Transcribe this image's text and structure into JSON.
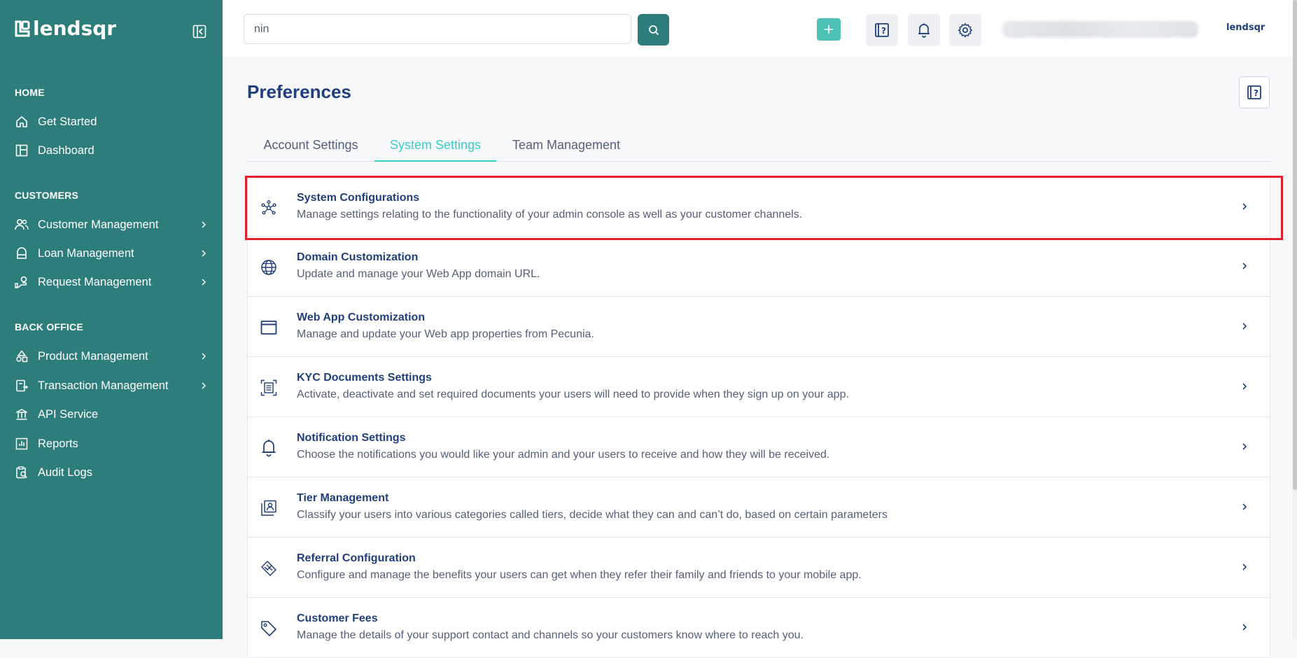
{
  "brand": {
    "name": "lendsqr",
    "small_name": "lendsqr"
  },
  "sidebar": {
    "sections": [
      {
        "label": "HOME",
        "items": [
          {
            "label": "Get Started",
            "icon": "home-icon",
            "has_submenu": false
          },
          {
            "label": "Dashboard",
            "icon": "dashboard-icon",
            "has_submenu": false
          }
        ]
      },
      {
        "label": "CUSTOMERS",
        "items": [
          {
            "label": "Customer Management",
            "icon": "users-icon",
            "has_submenu": true
          },
          {
            "label": "Loan Management",
            "icon": "loan-icon",
            "has_submenu": true
          },
          {
            "label": "Request Management",
            "icon": "request-icon",
            "has_submenu": true
          }
        ]
      },
      {
        "label": "BACK OFFICE",
        "items": [
          {
            "label": "Product Management",
            "icon": "product-icon",
            "has_submenu": true
          },
          {
            "label": "Transaction Management",
            "icon": "transaction-icon",
            "has_submenu": true
          },
          {
            "label": "API Service",
            "icon": "bank-icon",
            "has_submenu": false
          },
          {
            "label": "Reports",
            "icon": "reports-icon",
            "has_submenu": false
          },
          {
            "label": "Audit Logs",
            "icon": "audit-icon",
            "has_submenu": false
          }
        ]
      }
    ]
  },
  "search": {
    "value": "nin",
    "placeholder": ""
  },
  "page": {
    "title": "Preferences"
  },
  "tabs": [
    {
      "label": "Account Settings",
      "active": false
    },
    {
      "label": "System Settings",
      "active": true
    },
    {
      "label": "Team Management",
      "active": false
    }
  ],
  "settings": [
    {
      "title": "System Configurations",
      "description": "Manage settings relating to the functionality of your admin console as well as your customer channels.",
      "icon": "network-icon",
      "highlighted": true
    },
    {
      "title": "Domain Customization",
      "description": "Update and manage your Web App domain URL.",
      "icon": "globe-icon",
      "highlighted": false
    },
    {
      "title": "Web App Customization",
      "description": "Manage and update your Web app properties from Pecunia.",
      "icon": "window-icon",
      "highlighted": false
    },
    {
      "title": "KYC Documents Settings",
      "description": "Activate, deactivate and set required documents your users will need to provide when they sign up on your app.",
      "icon": "document-scan-icon",
      "highlighted": false
    },
    {
      "title": "Notification Settings",
      "description": "Choose the notifications you would like your admin and your users to receive and how they will be received.",
      "icon": "bell-icon",
      "highlighted": false
    },
    {
      "title": "Tier Management",
      "description": "Classify your users into various categories called tiers, decide what they can and can’t do, based on certain parameters",
      "icon": "tier-icon",
      "highlighted": false
    },
    {
      "title": "Referral Configuration",
      "description": "Configure and manage the benefits your users can get when they refer their family and friends to your mobile app.",
      "icon": "referral-icon",
      "highlighted": false
    },
    {
      "title": "Customer Fees",
      "description": "Manage the details of your support contact and channels so your customers know where to reach you.",
      "icon": "tag-icon",
      "highlighted": false
    }
  ],
  "colors": {
    "sidebar": "#2d7d7a",
    "accent": "#39cdcc",
    "primary_text": "#213f7d",
    "highlight_border": "#e0202a"
  }
}
